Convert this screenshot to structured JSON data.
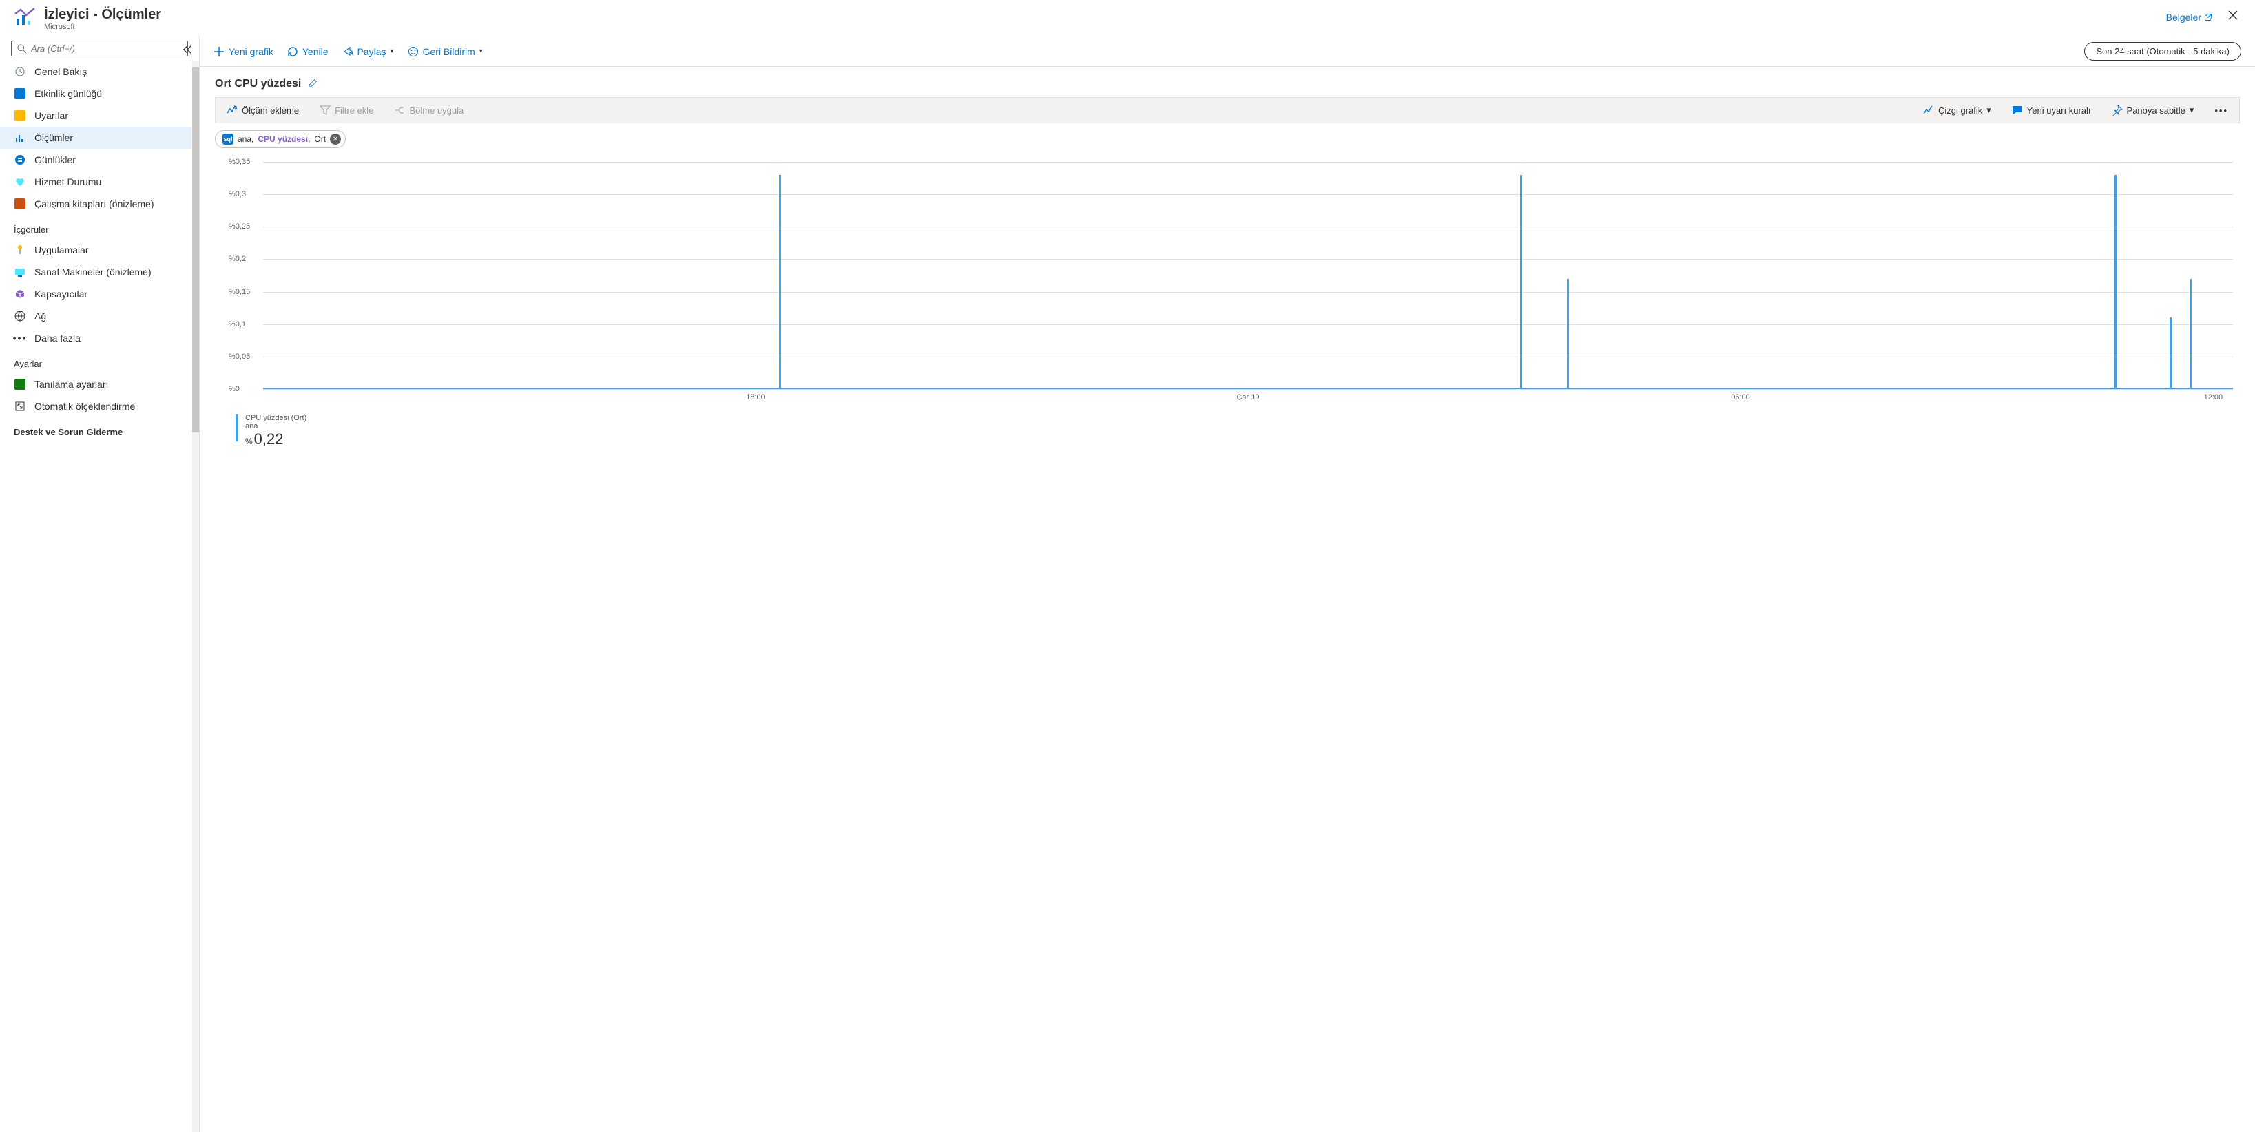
{
  "header": {
    "title": "İzleyici - Ölçümler",
    "subtitle": "Microsoft",
    "docs_link": "Belgeler"
  },
  "sidebar": {
    "search_placeholder": "Ara (Ctrl+/)",
    "items": [
      {
        "label": "Genel Bakış",
        "icon": "overview"
      },
      {
        "label": "Etkinlik günlüğü",
        "icon": "activity"
      },
      {
        "label": "Uyarılar",
        "icon": "alerts"
      },
      {
        "label": "Ölçümler",
        "icon": "metrics",
        "active": true
      },
      {
        "label": "Günlükler",
        "icon": "logs"
      },
      {
        "label": "Hizmet Durumu",
        "icon": "health"
      },
      {
        "label": "Çalışma kitapları (önizleme)",
        "icon": "workbooks"
      }
    ],
    "section_insights": "İçgörüler",
    "insights": [
      {
        "label": "Uygulamalar",
        "icon": "apps"
      },
      {
        "label": "Sanal Makineler (önizleme)",
        "icon": "vms"
      },
      {
        "label": "Kapsayıcılar",
        "icon": "containers"
      },
      {
        "label": "Ağ",
        "icon": "network"
      },
      {
        "label": "Daha fazla",
        "icon": "more"
      }
    ],
    "section_settings": "Ayarlar",
    "settings": [
      {
        "label": "Tanılama ayarları",
        "icon": "diag"
      },
      {
        "label": "Otomatik ölçeklendirme",
        "icon": "autoscale"
      }
    ],
    "section_support": "Destek ve Sorun Giderme"
  },
  "toolbar": {
    "new_chart": "Yeni grafik",
    "refresh": "Yenile",
    "share": "Paylaş",
    "feedback": "Geri Bildirim",
    "time_range": "Son 24 saat (Otomatik - 5 dakika)"
  },
  "chart": {
    "title": "Ort CPU yüzdesi",
    "add_metric": "Ölçüm ekleme",
    "add_filter": "Filtre ekle",
    "apply_split": "Bölme uygula",
    "chart_type": "Çizgi grafik",
    "new_alert": "Yeni uyarı kuralı",
    "pin": "Panoya sabitle"
  },
  "chip": {
    "scope": "ana,",
    "metric": "CPU yüzdesi,",
    "agg": "Ort"
  },
  "legend": {
    "label": "CPU yüzdesi (Ort)",
    "resource": "ana",
    "unit": "%",
    "value": "0,22"
  },
  "chart_data": {
    "type": "line",
    "ylabel": "",
    "xlabel": "",
    "ylim": [
      0,
      0.35
    ],
    "y_ticks": [
      "%0",
      "%0,05",
      "%0,1",
      "%0,15",
      "%0,2",
      "%0,25",
      "%0,3",
      "%0,35"
    ],
    "x_ticks": [
      {
        "pos": 25,
        "label": "18:00"
      },
      {
        "pos": 50,
        "label": "Çar 19"
      },
      {
        "pos": 75,
        "label": "06:00"
      },
      {
        "pos": 99,
        "label": "12:00"
      }
    ],
    "series": [
      {
        "name": "CPU yüzdesi (Ort)",
        "color": "#3aa0e8",
        "baseline": 0,
        "spikes": [
          {
            "x": 26.2,
            "value": 0.33
          },
          {
            "x": 63.8,
            "value": 0.33
          },
          {
            "x": 66.2,
            "value": 0.17
          },
          {
            "x": 94.0,
            "value": 0.33
          },
          {
            "x": 96.8,
            "value": 0.11
          },
          {
            "x": 97.8,
            "value": 0.17
          }
        ]
      }
    ]
  }
}
